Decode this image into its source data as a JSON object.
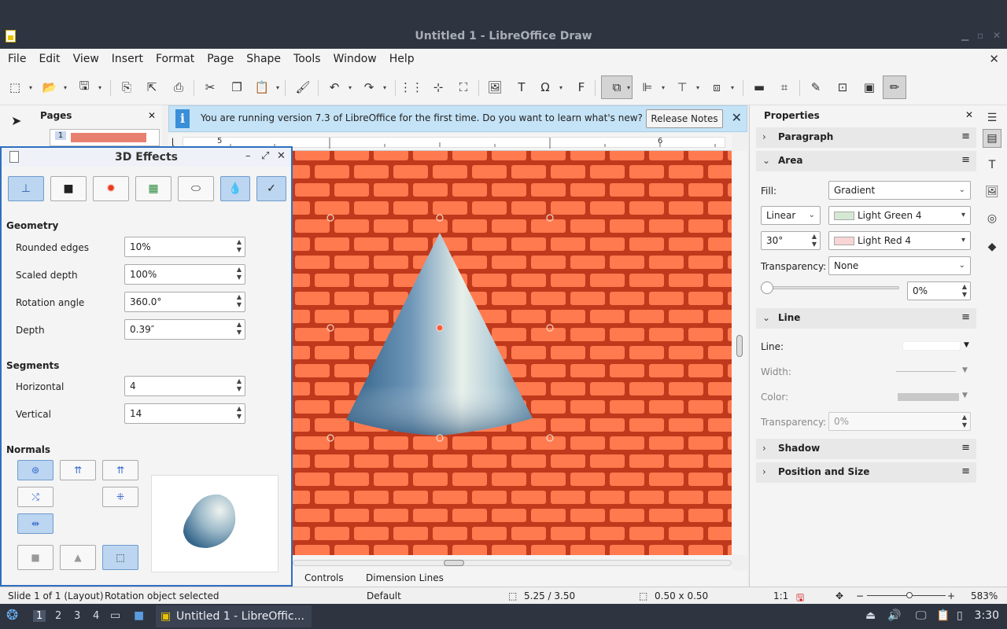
{
  "window": {
    "title": "Untitled 1 - LibreOffice Draw"
  },
  "menu": [
    "File",
    "Edit",
    "View",
    "Insert",
    "Format",
    "Page",
    "Shape",
    "Tools",
    "Window",
    "Help"
  ],
  "pages_panel": {
    "title": "Pages",
    "page_number": "1"
  },
  "infobar": {
    "message": "You are running version 7.3 of LibreOffice for the first time. Do you want to learn what's new?",
    "button": "Release Notes"
  },
  "ruler": {
    "labels": [
      "5",
      "6"
    ]
  },
  "dialog": {
    "title": "3D Effects",
    "geometry": {
      "heading": "Geometry",
      "rounded_edges": {
        "label": "Rounded edges",
        "value": "10%"
      },
      "scaled_depth": {
        "label": "Scaled depth",
        "value": "100%"
      },
      "rotation_angle": {
        "label": "Rotation angle",
        "value": "360.0°"
      },
      "depth": {
        "label": "Depth",
        "value": "0.39″"
      }
    },
    "segments": {
      "heading": "Segments",
      "horizontal": {
        "label": "Horizontal",
        "value": "4"
      },
      "vertical": {
        "label": "Vertical",
        "value": "14"
      }
    },
    "normals": {
      "heading": "Normals"
    }
  },
  "layer_tabs": [
    "Controls",
    "Dimension Lines"
  ],
  "sidebar": {
    "title": "Properties",
    "sections": {
      "paragraph": "Paragraph",
      "area": "Area",
      "line": "Line",
      "shadow": "Shadow",
      "position_size": "Position and Size"
    },
    "area": {
      "fill_label": "Fill:",
      "fill_value": "Gradient",
      "gradient_type": "Linear",
      "color_from": "Light Green 4",
      "color_from_hex": "#d5e8d4",
      "angle": "30°",
      "color_to": "Light Red 4",
      "color_to_hex": "#f7d5d5",
      "transparency_label": "Transparency:",
      "transparency_value": "None",
      "transparency_percent": "0%"
    },
    "line": {
      "line_label": "Line:",
      "width_label": "Width:",
      "color_label": "Color:",
      "transparency_label": "Transparency:",
      "transparency_value": "0%"
    }
  },
  "statusbar": {
    "slide": "Slide 1 of 1 (Layout)",
    "selection": "Rotation object selected",
    "master": "Default",
    "position": "5.25 / 3.50",
    "size": "0.50 x 0.50",
    "scale": "1:1",
    "zoom": "583%"
  },
  "taskbar": {
    "workspaces": [
      "1",
      "2",
      "3",
      "4"
    ],
    "task_label": "Untitled 1 - LibreOffic...",
    "clock": "3:30"
  }
}
